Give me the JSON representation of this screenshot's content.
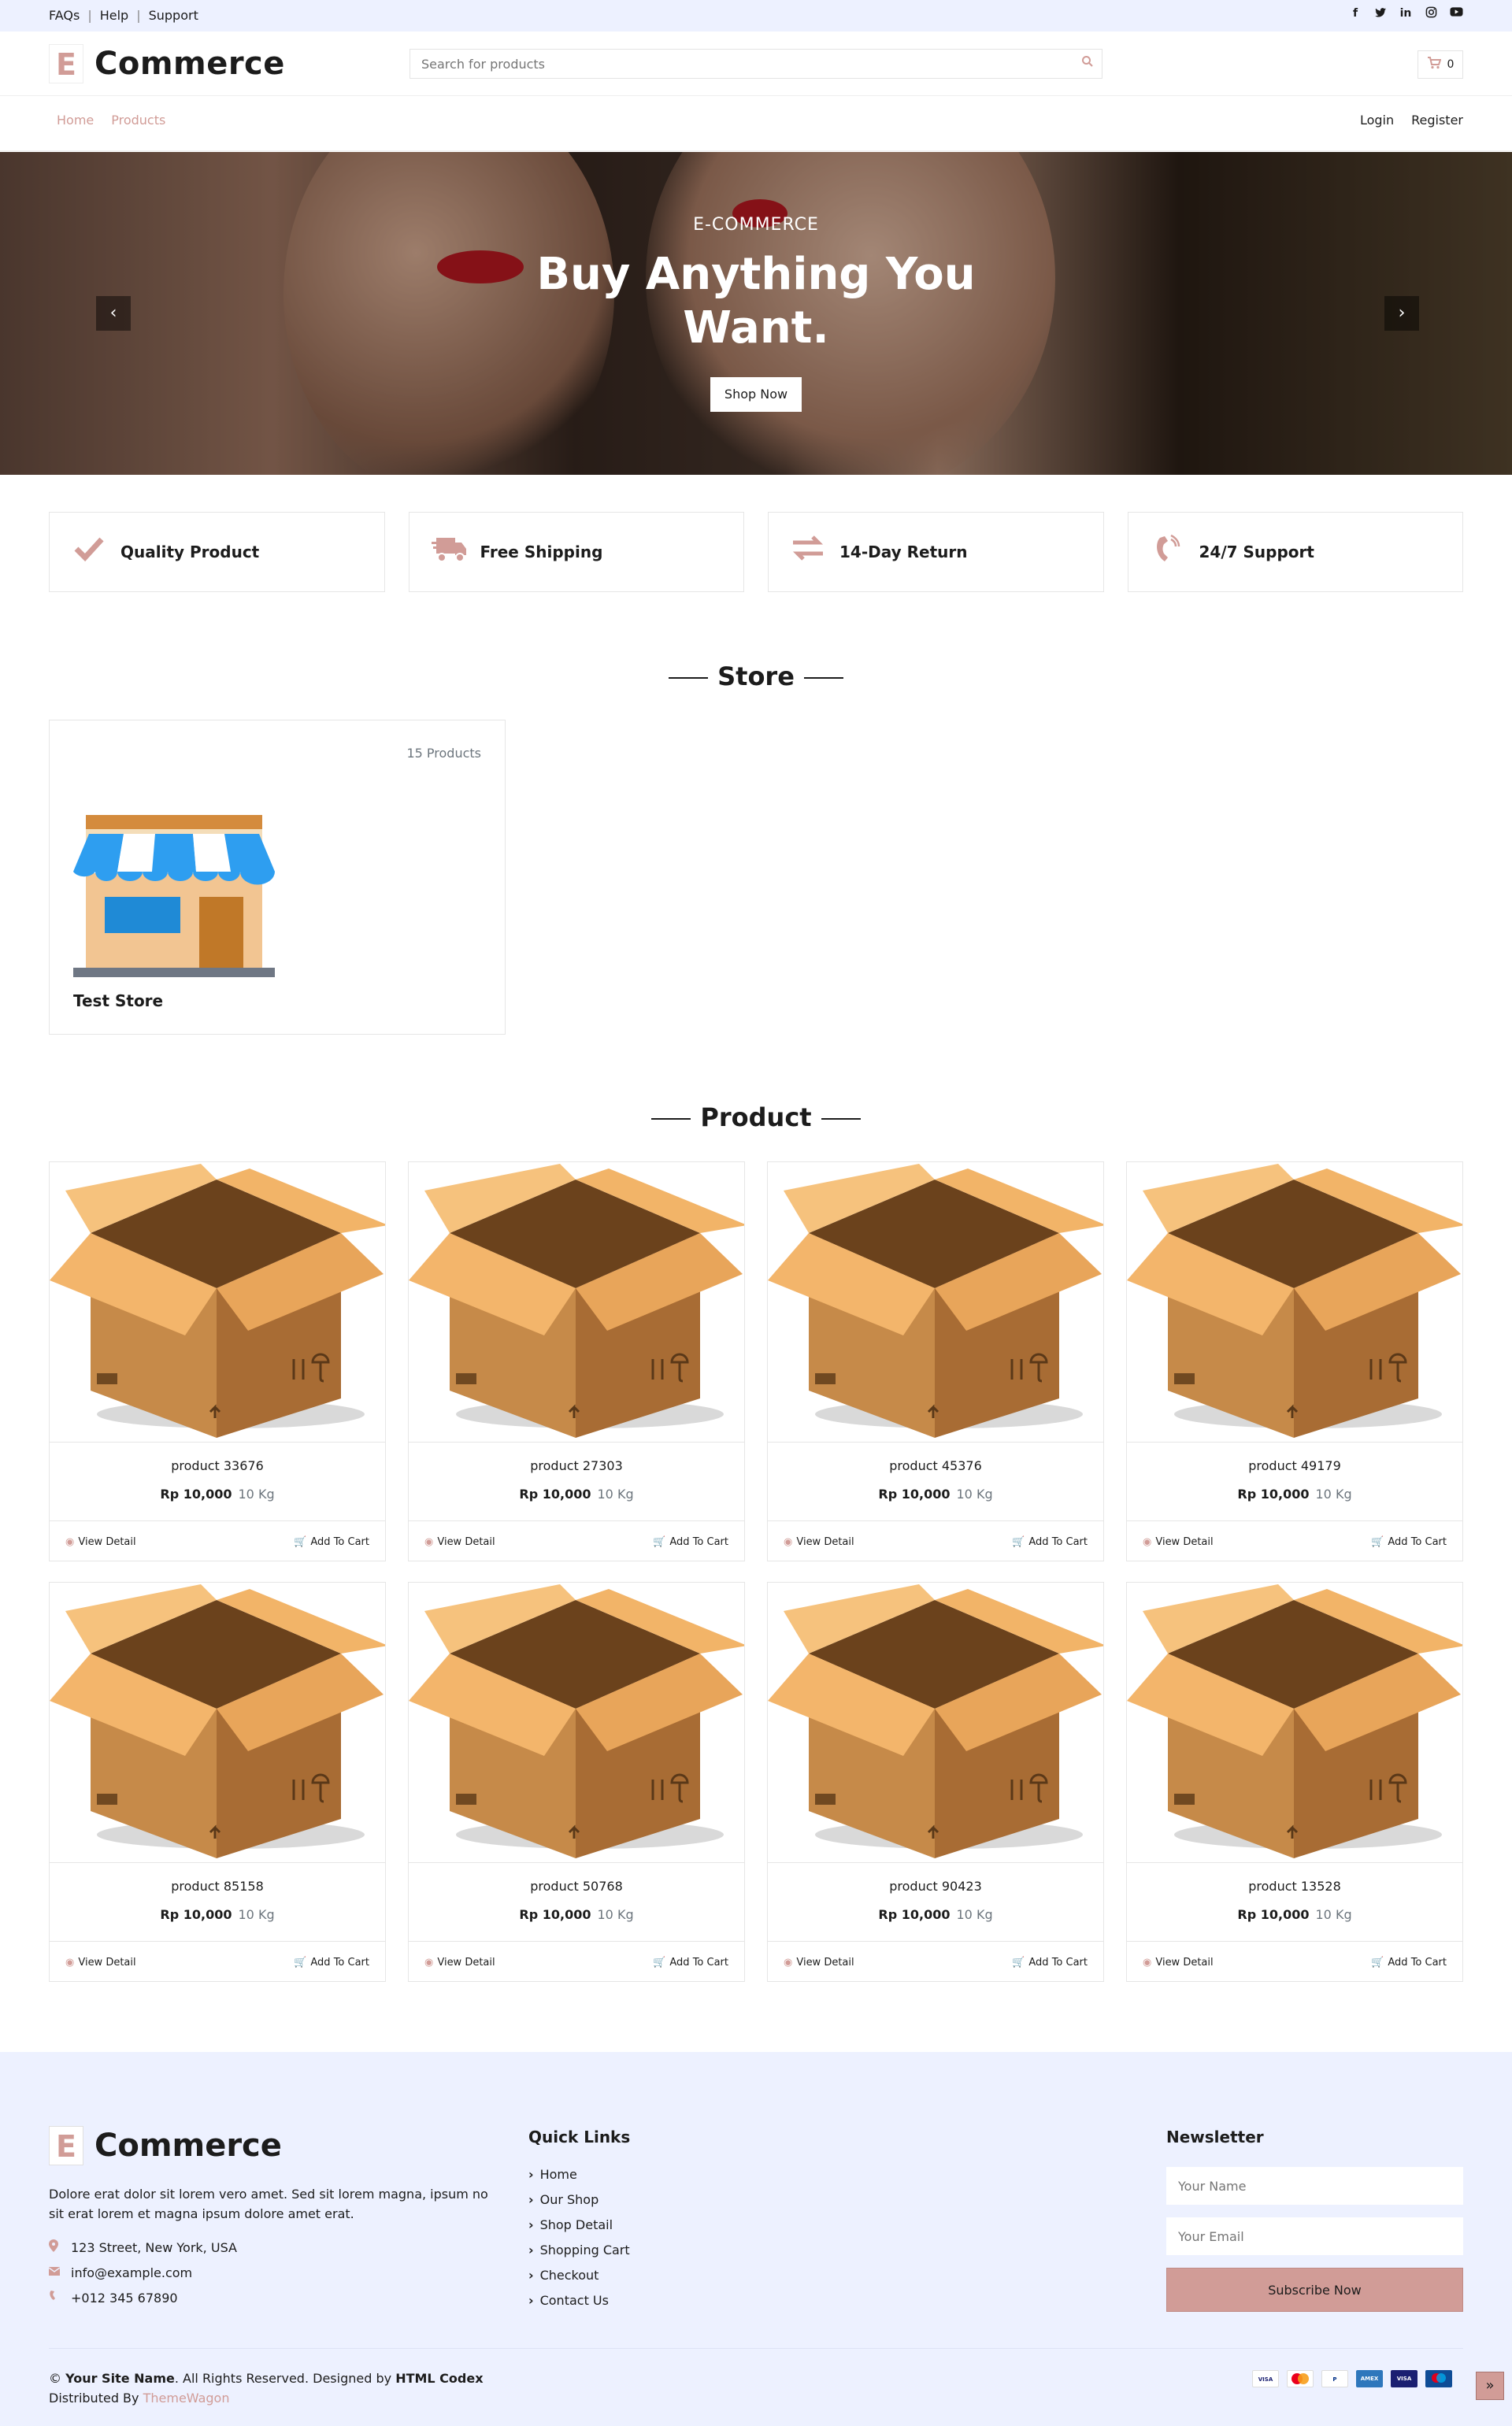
{
  "topbar": {
    "links": [
      "FAQs",
      "Help",
      "Support"
    ],
    "social_icons": [
      "facebook-icon",
      "twitter-icon",
      "linkedin-icon",
      "instagram-icon",
      "youtube-icon"
    ]
  },
  "header": {
    "logo_letter": "E",
    "logo_name": "Commerce",
    "search_placeholder": "Search for products",
    "cart_count": "0"
  },
  "nav": {
    "left": [
      "Home",
      "Products"
    ],
    "right": [
      "Login",
      "Register"
    ]
  },
  "hero": {
    "subtitle": "E-COMMERCE",
    "title": "Buy Anything You Want.",
    "button": "Shop Now"
  },
  "features": [
    {
      "icon": "check-icon",
      "label": "Quality Product"
    },
    {
      "icon": "shipping-truck-icon",
      "label": "Free Shipping"
    },
    {
      "icon": "exchange-icon",
      "label": "14-Day Return"
    },
    {
      "icon": "phone-volume-icon",
      "label": "24/7 Support"
    }
  ],
  "store_section": {
    "title": "Store",
    "card": {
      "count": "15 Products",
      "name": "Test Store"
    }
  },
  "product_section": {
    "title": "Product",
    "view_label": "View Detail",
    "cart_label": "Add To Cart",
    "products": [
      {
        "name": "product 33676",
        "price": "Rp 10,000",
        "weight": "10 Kg"
      },
      {
        "name": "product 27303",
        "price": "Rp 10,000",
        "weight": "10 Kg"
      },
      {
        "name": "product 45376",
        "price": "Rp 10,000",
        "weight": "10 Kg"
      },
      {
        "name": "product 49179",
        "price": "Rp 10,000",
        "weight": "10 Kg"
      },
      {
        "name": "product 85158",
        "price": "Rp 10,000",
        "weight": "10 Kg"
      },
      {
        "name": "product 50768",
        "price": "Rp 10,000",
        "weight": "10 Kg"
      },
      {
        "name": "product 90423",
        "price": "Rp 10,000",
        "weight": "10 Kg"
      },
      {
        "name": "product 13528",
        "price": "Rp 10,000",
        "weight": "10 Kg"
      }
    ]
  },
  "footer": {
    "logo_letter": "E",
    "logo_name": "Commerce",
    "description": "Dolore erat dolor sit lorem vero amet. Sed sit lorem magna, ipsum no sit erat lorem et magna ipsum dolore amet erat.",
    "address": "123 Street, New York, USA",
    "email": "info@example.com",
    "phone": "+012 345 67890",
    "quick_links_title": "Quick Links",
    "quick_links": [
      "Home",
      "Our Shop",
      "Shop Detail",
      "Shopping Cart",
      "Checkout",
      "Contact Us"
    ],
    "newsletter_title": "Newsletter",
    "name_placeholder": "Your Name",
    "email_placeholder": "Your Email",
    "subscribe": "Subscribe Now",
    "copyright_prefix": "©",
    "site_name": "Your Site Name",
    "rights": ". All Rights Reserved. Designed by",
    "designer": "HTML Codex",
    "distributed": "Distributed By",
    "distributor": "ThemeWagon",
    "payment_icons": [
      "visa-icon",
      "mastercard-icon",
      "paypal-icon",
      "amex-icon",
      "visa-electron-icon",
      "maestro-icon"
    ]
  },
  "colors": {
    "accent": "#d19c97",
    "light_bg": "#edf1ff",
    "text": "#1c1c1c",
    "muted": "#6c757d"
  }
}
